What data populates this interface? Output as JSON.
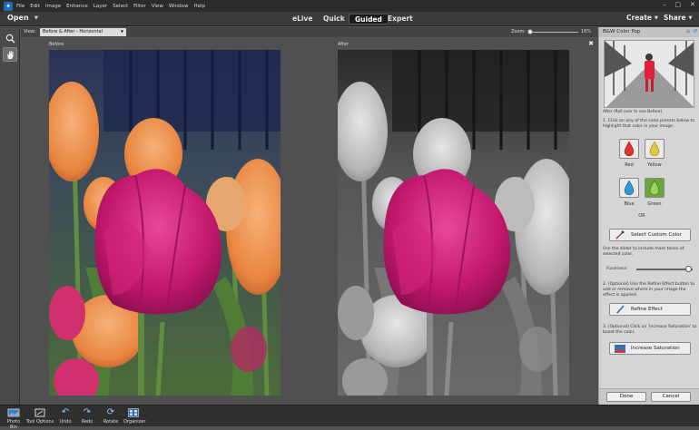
{
  "menubar": {
    "items": [
      "File",
      "Edit",
      "Image",
      "Enhance",
      "Layer",
      "Select",
      "Filter",
      "View",
      "Window",
      "Help"
    ],
    "window_controls": [
      "–",
      "□",
      "✕"
    ]
  },
  "modebar": {
    "open_label": "Open",
    "modes": [
      "eLive",
      "Quick",
      "Guided",
      "Expert"
    ],
    "active_mode": "Guided",
    "create_label": "Create",
    "share_label": "Share"
  },
  "optbar": {
    "view_label": "View:",
    "view_value": "Before & After - Horizontal",
    "zoom_label": "Zoom:",
    "zoom_value": "16%"
  },
  "canvas": {
    "before_label": "Before",
    "after_label": "After",
    "close_glyph": "✖"
  },
  "panel": {
    "title": "B&W Color Pop",
    "thumb_caption": "After (Roll over to see Before)",
    "step1": "1. Click on any of the color presets below to highlight that color in your image.",
    "swatches": [
      {
        "name": "Red",
        "color": "#d4382e"
      },
      {
        "name": "Yellow",
        "color": "#e3c93a"
      },
      {
        "name": "Blue",
        "color": "#2f9bd6"
      },
      {
        "name": "Green",
        "color": "#6aa63a"
      }
    ],
    "or_label": "OR",
    "custom_button": "Select Custom Color",
    "slider_text": "Use the slider to include more tones of selected color.",
    "fuzziness_label": "Fuzziness:",
    "fuzziness_value": 0.92,
    "step2": "2. (Optional) Use the Refine Effect button to add or remove where in your image the effect is applied.",
    "refine_button": "Refine Effect",
    "step3": "3. (Optional) Click on 'Increase Saturation' to boost the color.",
    "saturation_button": "Increase Saturation",
    "done_button": "Done",
    "cancel_button": "Cancel"
  },
  "bottombar": {
    "items": [
      "Photo Bin",
      "Tool Options",
      "Undo",
      "Redo",
      "Rotate",
      "Organizer"
    ]
  },
  "colors": {
    "accent": "#1e6db8",
    "tulip_magenta": "#c2186e"
  }
}
